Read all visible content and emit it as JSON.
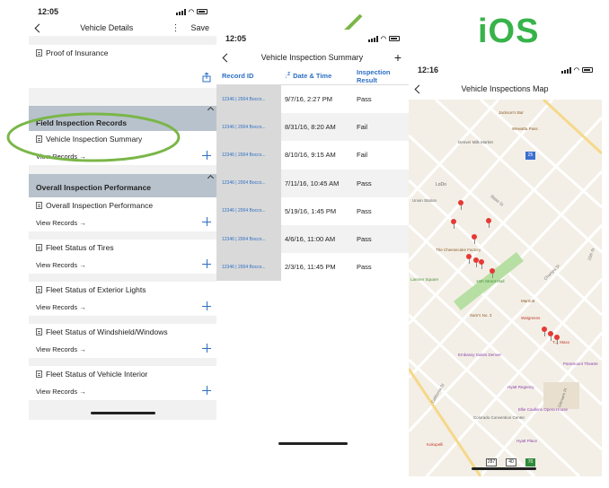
{
  "platform_label": "iOS",
  "colors": {
    "accent": "#2d6fc4",
    "highlight": "#7ab648",
    "ios_green": "#37b34a",
    "section_bg": "#b8c2cc",
    "pin": "#e53935"
  },
  "screen1": {
    "time": "12:05",
    "title": "Vehicle Details",
    "save": "Save",
    "proof": "Proof of Insurance",
    "section1": "Field Inspection Records",
    "section2": "Overall Inspection Performance",
    "cards1": [
      {
        "title": "Vehicle Inspection Summary",
        "view": "View Records →"
      }
    ],
    "cards2": [
      {
        "title": "Overall Inspection Performance",
        "view": "View Records →"
      },
      {
        "title": "Fleet Status of Tires",
        "view": "View Records →"
      },
      {
        "title": "Fleet Status of Exterior Lights",
        "view": "View Records →"
      },
      {
        "title": "Fleet Status of Windshield/Windows",
        "view": "View Records →"
      },
      {
        "title": "Fleet Status of Vehicle Interior",
        "view": "View Records →"
      }
    ]
  },
  "screen2": {
    "time": "12:05",
    "title": "Vehicle Inspection Summary",
    "columns": [
      "Record ID",
      "Date & Time",
      "Inspection Result"
    ],
    "rows": [
      {
        "id": "12346 | 2004 Bocco...",
        "date": "9/7/16, 2:27 PM",
        "result": "Pass"
      },
      {
        "id": "12346 | 2004 Bocco...",
        "date": "8/31/16, 8:20 AM",
        "result": "Fail"
      },
      {
        "id": "12346 | 2004 Bocco...",
        "date": "8/10/16, 9:15 AM",
        "result": "Fail"
      },
      {
        "id": "12346 | 2004 Bocco...",
        "date": "7/11/16, 10:45 AM",
        "result": "Pass"
      },
      {
        "id": "12346 | 2004 Bocco...",
        "date": "5/19/16, 1:45 PM",
        "result": "Pass"
      },
      {
        "id": "12346 | 2004 Bocco...",
        "date": "4/6/16, 11:00 AM",
        "result": "Pass"
      },
      {
        "id": "12346 | 2004 Bocco...",
        "date": "2/3/16, 11:45 PM",
        "result": "Pass"
      }
    ]
  },
  "screen3": {
    "time": "12:16",
    "title": "Vehicle Inspections Map",
    "places": [
      "Jackson's Bar",
      "Wewatta Pass",
      "Denver Milk Market",
      "LoDo",
      "The Cheesecake Factory",
      "16th Street Mall",
      "Larimer Square",
      "Marriott",
      "Walgreens",
      "T.J. Maxx",
      "Sam's No. 3",
      "Embassy Suites Denver",
      "Colorado Convention Center",
      "Hyatt Regency",
      "Paramount Theatre",
      "Ellie Caulkins Opera House",
      "Hyatt Place",
      "Kokopelli",
      "Union Station"
    ],
    "streets": [
      "Blake St",
      "Market St",
      "Stout St",
      "15th St",
      "California St",
      "Champa St",
      "Welton St",
      "Tremont Pl",
      "Court Pl",
      "Glenarm Pl",
      "Broadway"
    ],
    "shields": [
      "25",
      "287",
      "40",
      "70"
    ]
  }
}
